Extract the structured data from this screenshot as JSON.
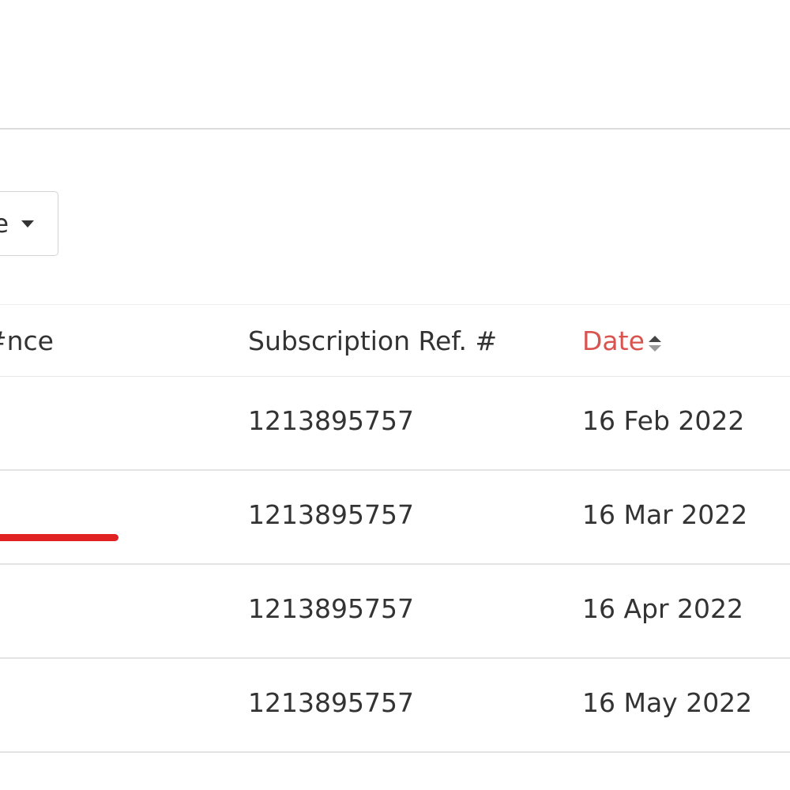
{
  "filter": {
    "dropdown_label": "e"
  },
  "table": {
    "headers": {
      "reference": "nce#",
      "subscription_ref": "Subscription Ref. #",
      "date": "Date"
    },
    "rows": [
      {
        "subscription_ref": "1213895757",
        "date": "16 Feb 2022"
      },
      {
        "subscription_ref": "1213895757",
        "date": "16 Mar 2022"
      },
      {
        "subscription_ref": "1213895757",
        "date": "16 Apr 2022"
      },
      {
        "subscription_ref": "1213895757",
        "date": "16 May 2022"
      }
    ]
  },
  "colors": {
    "active_sort_header": "#d9534f",
    "annotation_mark": "#e02222",
    "divider": "#dcdcdc"
  },
  "icons": {
    "sort": "sort-icon",
    "dropdown": "caret-down-icon"
  }
}
